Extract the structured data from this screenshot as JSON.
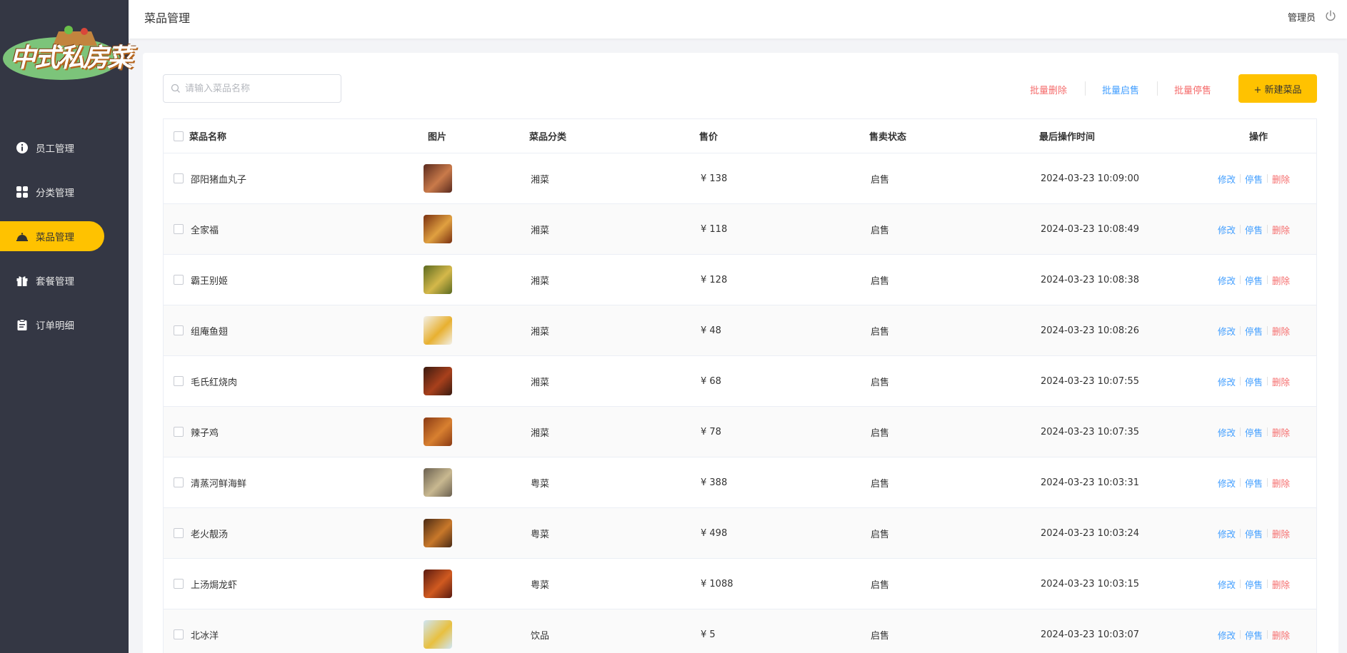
{
  "app": {
    "logo_text": "中式私房菜",
    "page_title": "菜品管理",
    "user_name": "管理员"
  },
  "sidebar": {
    "items": [
      {
        "label": "员工管理",
        "icon": "employee-icon",
        "active": false
      },
      {
        "label": "分类管理",
        "icon": "category-icon",
        "active": false
      },
      {
        "label": "菜品管理",
        "icon": "dish-icon",
        "active": true
      },
      {
        "label": "套餐管理",
        "icon": "gift-icon",
        "active": false
      },
      {
        "label": "订单明细",
        "icon": "clipboard-icon",
        "active": false
      }
    ]
  },
  "toolbar": {
    "search_placeholder": "请输入菜品名称",
    "batch_delete": "批量删除",
    "batch_enable": "批量启售",
    "batch_disable": "批量停售",
    "add_button": "+ 新建菜品"
  },
  "colors": {
    "accent": "#ffc200",
    "sidebar_bg": "#343744",
    "link_blue": "#419eff",
    "danger_red": "#f56c6c"
  },
  "table": {
    "headers": {
      "name": "菜品名称",
      "image": "图片",
      "category": "菜品分类",
      "price": "售价",
      "status": "售卖状态",
      "updated": "最后操作时间",
      "actions": "操作"
    },
    "action_labels": {
      "edit": "修改",
      "stop": "停售",
      "delete": "删除"
    },
    "rows": [
      {
        "name": "邵阳猪血丸子",
        "category": "湘菜",
        "price": "¥ 138",
        "status": "启售",
        "updated": "2024-03-23 10:09:00",
        "thumb_colors": [
          "#5a2a1e",
          "#c97a4a"
        ]
      },
      {
        "name": "全家福",
        "category": "湘菜",
        "price": "¥ 118",
        "status": "启售",
        "updated": "2024-03-23 10:08:49",
        "thumb_colors": [
          "#7a3010",
          "#e0a040"
        ]
      },
      {
        "name": "霸王别姬",
        "category": "湘菜",
        "price": "¥ 128",
        "status": "启售",
        "updated": "2024-03-23 10:08:38",
        "thumb_colors": [
          "#5b6a20",
          "#d4b84a"
        ]
      },
      {
        "name": "组庵鱼翅",
        "category": "湘菜",
        "price": "¥ 48",
        "status": "启售",
        "updated": "2024-03-23 10:08:26",
        "thumb_colors": [
          "#f2f0e8",
          "#e8b030"
        ]
      },
      {
        "name": "毛氏红烧肉",
        "category": "湘菜",
        "price": "¥ 68",
        "status": "启售",
        "updated": "2024-03-23 10:07:55",
        "thumb_colors": [
          "#3a1a10",
          "#a8401c"
        ]
      },
      {
        "name": "辣子鸡",
        "category": "湘菜",
        "price": "¥ 78",
        "status": "启售",
        "updated": "2024-03-23 10:07:35",
        "thumb_colors": [
          "#8a3a14",
          "#d88030"
        ]
      },
      {
        "name": "清蒸河鲜海鲜",
        "category": "粤菜",
        "price": "¥ 388",
        "status": "启售",
        "updated": "2024-03-23 10:03:31",
        "thumb_colors": [
          "#6a6050",
          "#c8b890"
        ]
      },
      {
        "name": "老火靓汤",
        "category": "粤菜",
        "price": "¥ 498",
        "status": "启售",
        "updated": "2024-03-23 10:03:24",
        "thumb_colors": [
          "#4a2a14",
          "#c8782a"
        ]
      },
      {
        "name": "上汤焗龙虾",
        "category": "粤菜",
        "price": "¥ 1088",
        "status": "启售",
        "updated": "2024-03-23 10:03:15",
        "thumb_colors": [
          "#5a1a10",
          "#d05a20"
        ]
      },
      {
        "name": "北冰洋",
        "category": "饮品",
        "price": "¥ 5",
        "status": "启售",
        "updated": "2024-03-23 10:03:07",
        "thumb_colors": [
          "#cfe6f5",
          "#e8c040"
        ]
      }
    ]
  }
}
